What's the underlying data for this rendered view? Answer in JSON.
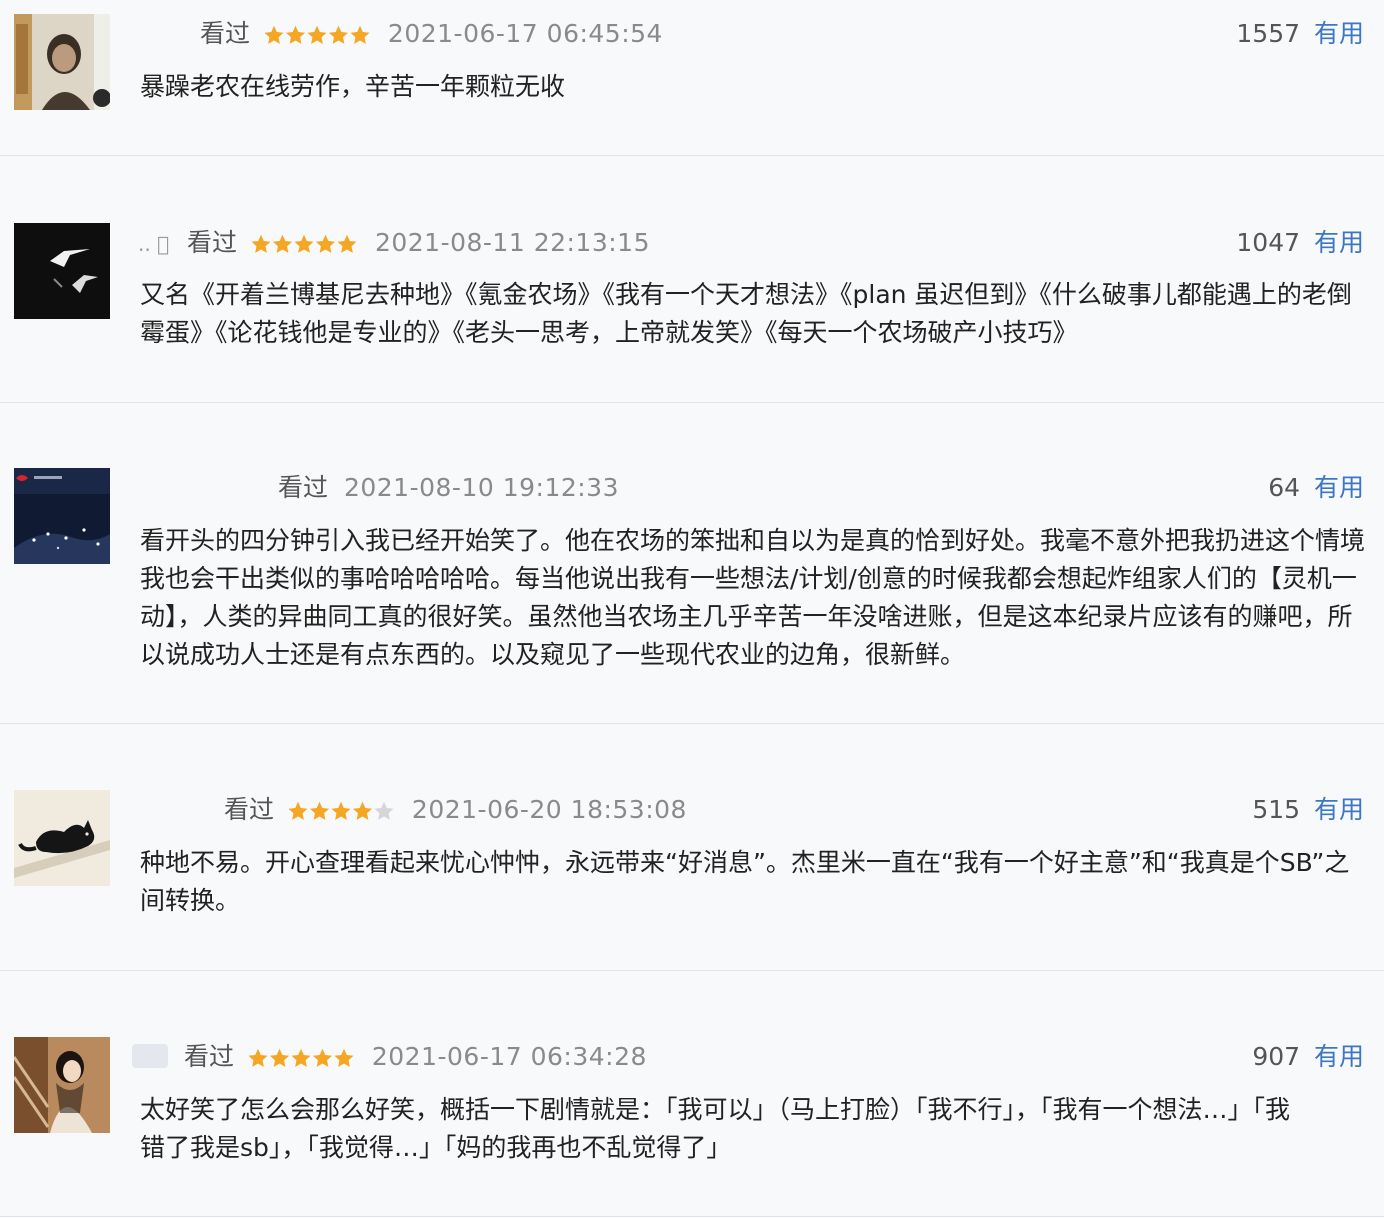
{
  "colors": {
    "star": "#f5a623",
    "star_empty": "#d6d6d6",
    "useful": "#3d77c4"
  },
  "reviews": [
    {
      "status": "看过",
      "stars": 5,
      "time": "2021-06-17 06:45:54",
      "count": "1557",
      "useful_label": "有用",
      "text": "暴躁老农在线劳作，辛苦一年颗粒无收"
    },
    {
      "user_name": ".. ﾞ",
      "status": "看过",
      "stars": 5,
      "time": "2021-08-11 22:13:15",
      "count": "1047",
      "useful_label": "有用",
      "text": "又名《开着兰博基尼去种地》《氪金农场》《我有一个天才想法》《plan 虽迟但到》《什么破事儿都能遇上的老倒霉蛋》《论花钱他是专业的》《老头一思考，上帝就发笑》《每天一个农场破产小技巧》"
    },
    {
      "status": "看过",
      "stars": 0,
      "time": "2021-08-10 19:12:33",
      "count": "64",
      "useful_label": "有用",
      "text": "看开头的四分钟引入我已经开始笑了。他在农场的笨拙和自以为是真的恰到好处。我毫不意外把我扔进这个情境我也会干出类似的事哈哈哈哈哈。每当他说出我有一些想法/计划/创意的时候我都会想起炸组家人们的【灵机一动】，人类的异曲同工真的很好笑。虽然他当农场主几乎辛苦一年没啥进账，但是这本纪录片应该有的赚吧，所以说成功人士还是有点东西的。以及窥见了一些现代农业的边角，很新鲜。"
    },
    {
      "status": "看过",
      "stars": 4,
      "time": "2021-06-20 18:53:08",
      "count": "515",
      "useful_label": "有用",
      "text": "种地不易。开心查理看起来忧心忡忡，永远带来“好消息”。杰里米一直在“我有一个好主意”和“我真是个SB”之间转换。"
    },
    {
      "status": "看过",
      "stars": 5,
      "time": "2021-06-17 06:34:28",
      "count": "907",
      "useful_label": "有用",
      "text": "太好笑了怎么会那么好笑，概括一下剧情就是：「我可以」（马上打脸）「我不行」，「我有一个想法…」「我错了我是sb」，「我觉得…」「妈的我再也不乱觉得了」"
    }
  ]
}
